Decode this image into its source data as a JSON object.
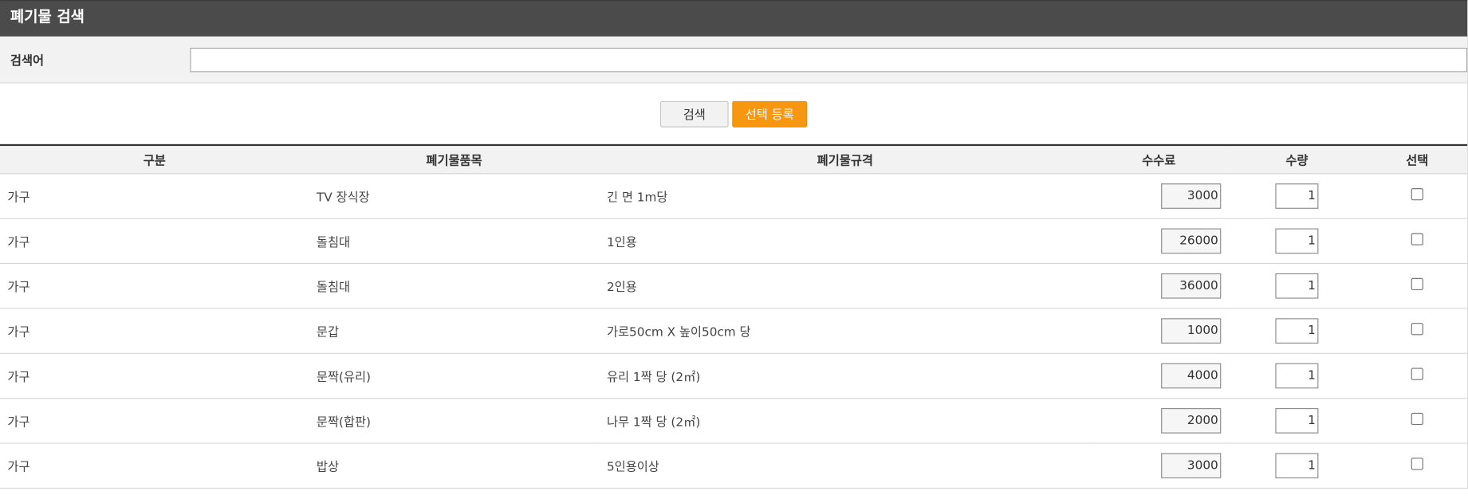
{
  "header": {
    "title": "폐기물 검색"
  },
  "search": {
    "label": "검색어",
    "value": "",
    "placeholder": ""
  },
  "buttons": {
    "search_label": "검색",
    "register_label": "선택 등록"
  },
  "table": {
    "headers": [
      "구분",
      "폐기물품목",
      "폐기물규격",
      "수수료",
      "수량",
      "선택"
    ],
    "rows": [
      {
        "category": "가구",
        "item": "TV 장식장",
        "spec": "긴 면 1m당",
        "fee": "3000",
        "qty": "1"
      },
      {
        "category": "가구",
        "item": "돌침대",
        "spec": "1인용",
        "fee": "26000",
        "qty": "1"
      },
      {
        "category": "가구",
        "item": "돌침대",
        "spec": "2인용",
        "fee": "36000",
        "qty": "1"
      },
      {
        "category": "가구",
        "item": "문갑",
        "spec": "가로50cm X 높이50cm 당",
        "fee": "1000",
        "qty": "1"
      },
      {
        "category": "가구",
        "item": "문짝(유리)",
        "spec": "유리 1짝 당 (2㎡)",
        "fee": "4000",
        "qty": "1"
      },
      {
        "category": "가구",
        "item": "문짝(합판)",
        "spec": "나무 1짝 당 (2㎡)",
        "fee": "2000",
        "qty": "1"
      },
      {
        "category": "가구",
        "item": "밥상",
        "spec": "5인용이상",
        "fee": "3000",
        "qty": "1"
      }
    ]
  }
}
